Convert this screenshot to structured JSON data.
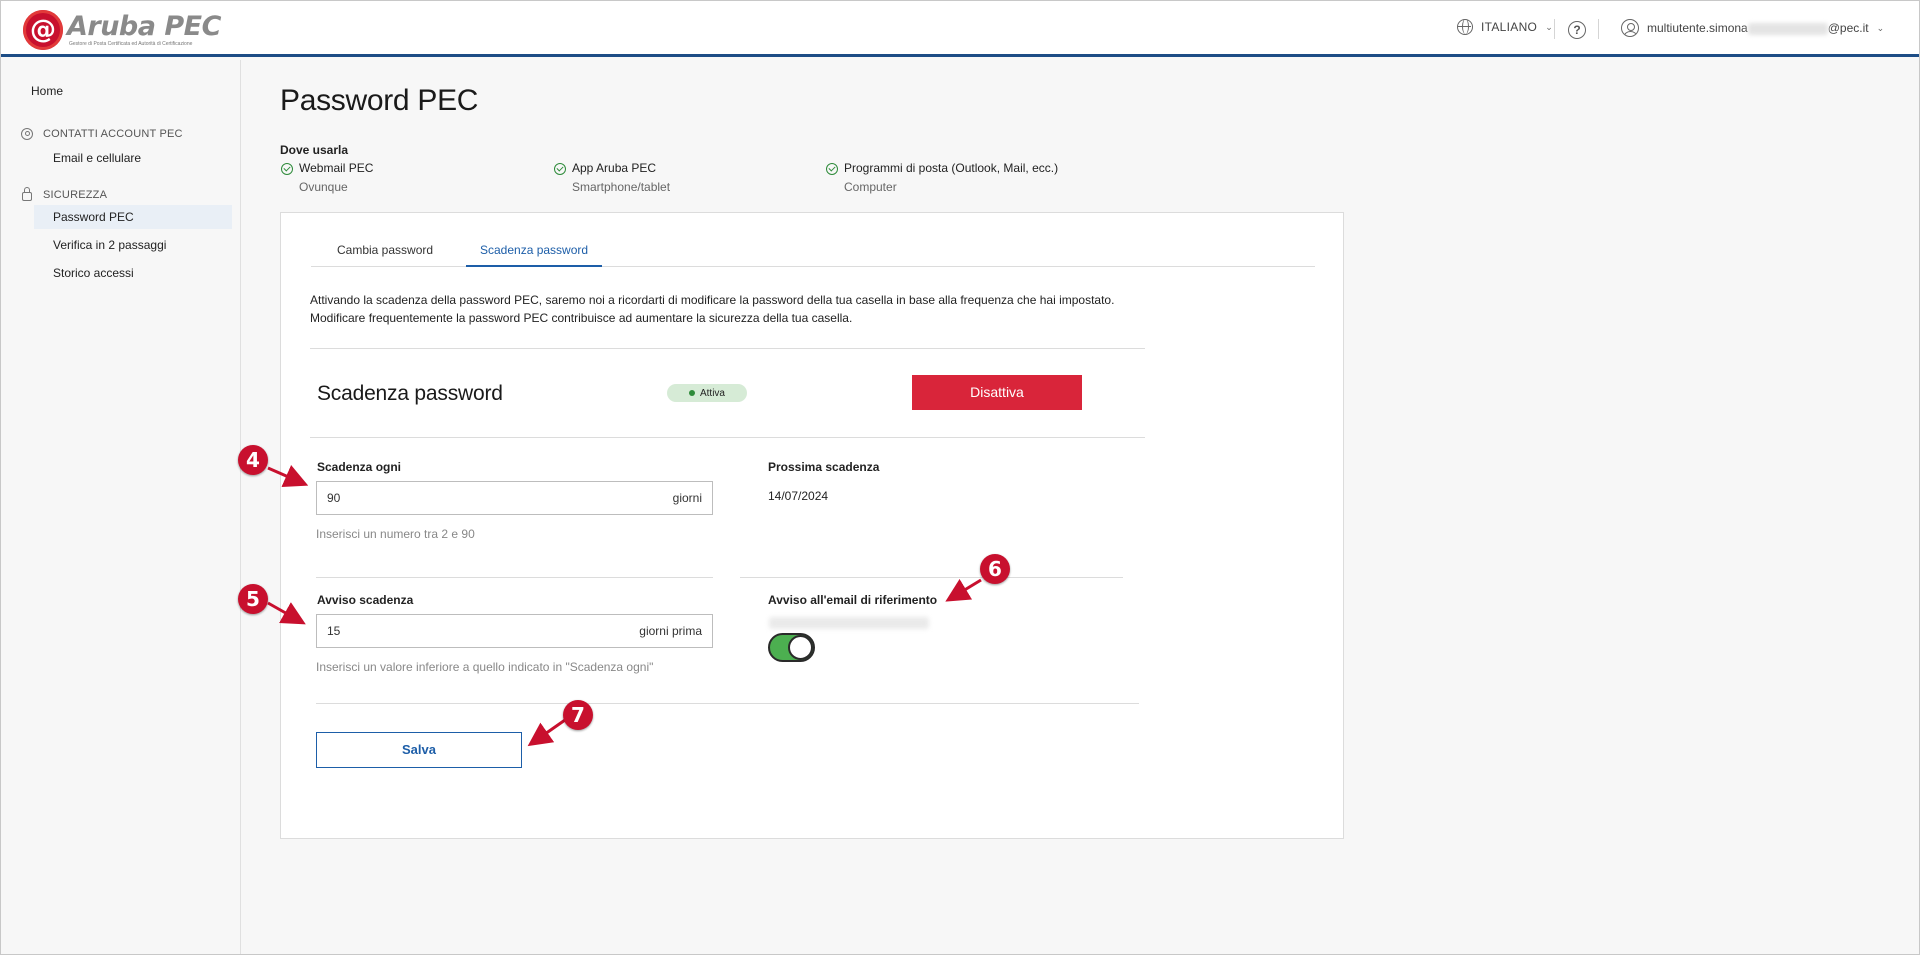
{
  "header": {
    "brand": "Aruba PEC",
    "tagline": "Gestore di Posta Certificata ed Autorità di Certificazione",
    "language": "ITALIANO",
    "help": "?",
    "user_prefix": "multiutente.simona",
    "user_suffix": "@pec.it"
  },
  "sidebar": {
    "home": "Home",
    "sections": [
      {
        "label": "CONTATTI ACCOUNT PEC",
        "items": [
          "Email e cellulare"
        ]
      },
      {
        "label": "SICUREZZA",
        "items": [
          "Password PEC",
          "Verifica in 2 passaggi",
          "Storico accessi"
        ]
      }
    ],
    "active_item": "Password PEC"
  },
  "main": {
    "title": "Password PEC",
    "where_label": "Dove usarla",
    "where": [
      {
        "title": "Webmail PEC",
        "sub": "Ovunque"
      },
      {
        "title": "App Aruba PEC",
        "sub": "Smartphone/tablet"
      },
      {
        "title": "Programmi di posta (Outlook, Mail, ecc.)",
        "sub": "Computer"
      }
    ],
    "tabs": [
      {
        "label": "Cambia password",
        "active": false
      },
      {
        "label": "Scadenza password",
        "active": true
      }
    ],
    "description_line1": "Attivando la scadenza della password PEC, saremo noi a ricordarti di modificare la password della tua casella in base alla frequenza che hai impostato.",
    "description_line2": "Modificare frequentemente la password PEC contribuisce ad aumentare la sicurezza della tua casella.",
    "section_title": "Scadenza password",
    "status_badge": "Attiva",
    "disable_button": "Disattiva",
    "expiry": {
      "label": "Scadenza ogni",
      "value": "90",
      "unit": "giorni",
      "hint": "Inserisci un numero tra 2 e 90"
    },
    "next_expiry": {
      "label": "Prossima scadenza",
      "value": "14/07/2024"
    },
    "warning": {
      "label": "Avviso scadenza",
      "value": "15",
      "unit": "giorni prima",
      "hint": "Inserisci un valore inferiore a quello indicato in \"Scadenza ogni\""
    },
    "email_notice": {
      "label": "Avviso all'email di riferimento",
      "enabled": true
    },
    "save_button": "Salva"
  },
  "annotations": [
    "4",
    "5",
    "6",
    "7"
  ],
  "colors": {
    "accent": "#1d5ea8",
    "danger": "#d9253a",
    "success": "#4caf50",
    "brand_red": "#c8102e",
    "header_border": "#1d4d86"
  }
}
